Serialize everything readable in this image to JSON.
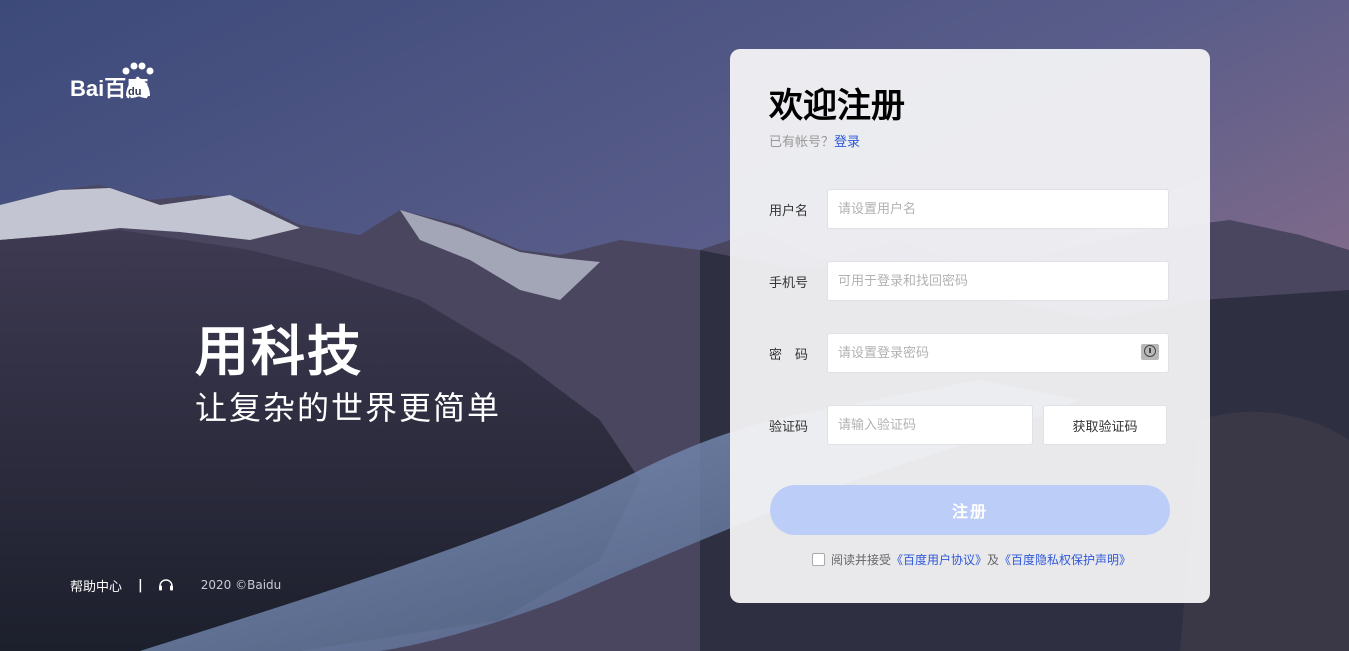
{
  "brand": {
    "logo_text": "Bai百度",
    "logo_accent": "du"
  },
  "slogan": {
    "line1": "用科技",
    "line2": "让复杂的世界更简单"
  },
  "footer": {
    "help": "帮助中心",
    "separator": "|",
    "copyright": "2020 ©Baidu"
  },
  "form": {
    "title": "欢迎注册",
    "has_account": "已有帐号？",
    "login_link": "登录",
    "username": {
      "label": "用户名",
      "placeholder": "请设置用户名",
      "value": ""
    },
    "phone": {
      "label": "手机号",
      "placeholder": "可用于登录和找回密码",
      "value": ""
    },
    "password": {
      "label": "密　码",
      "placeholder": "请设置登录密码",
      "value": ""
    },
    "code": {
      "label": "验证码",
      "placeholder": "请输入验证码",
      "value": ""
    },
    "get_code": "获取验证码",
    "submit": "注册",
    "agree_prefix": "阅读并接受",
    "terms_link": "《百度用户协议》",
    "agree_and": "及",
    "privacy_link": "《百度隐私权保护声明》"
  },
  "colors": {
    "accent": "#2e58d8",
    "submit_bg": "#bccdf8",
    "card_bg": "#f3f3f6"
  },
  "icons": [
    "baidu-paw-icon",
    "headset-icon",
    "eye-toggle-icon"
  ]
}
